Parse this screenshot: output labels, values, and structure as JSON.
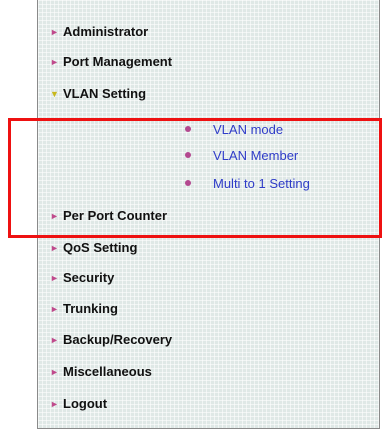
{
  "menu": {
    "items": [
      {
        "label": "Administrator"
      },
      {
        "label": "Port Management"
      },
      {
        "label": "VLAN Setting"
      },
      {
        "label": "Per Port Counter"
      },
      {
        "label": "QoS Setting"
      },
      {
        "label": "Security"
      },
      {
        "label": "Trunking"
      },
      {
        "label": "Backup/Recovery"
      },
      {
        "label": "Miscellaneous"
      },
      {
        "label": "Logout"
      }
    ],
    "vlan_submenu": [
      {
        "label": "VLAN mode"
      },
      {
        "label": "VLAN Member"
      },
      {
        "label": "Multi to 1 Setting"
      }
    ]
  },
  "colors": {
    "highlight_border": "#ee1111",
    "submenu_text": "#2f3cc8",
    "arrow": "#c04a8c",
    "arrow_open": "#c8b81e"
  }
}
